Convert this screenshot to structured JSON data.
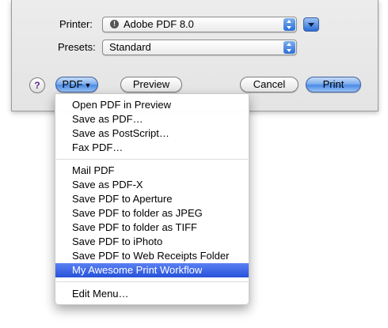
{
  "dialog": {
    "printer_label": "Printer:",
    "printer_value": "Adobe PDF 8.0",
    "presets_label": "Presets:",
    "presets_value": "Standard",
    "help_label": "?",
    "pdf_button": "PDF",
    "preview_button": "Preview",
    "cancel_button": "Cancel",
    "print_button": "Print"
  },
  "pdf_menu": {
    "group1": [
      "Open PDF in Preview",
      "Save as PDF…",
      "Save as PostScript…",
      "Fax PDF…"
    ],
    "group2": [
      "Mail PDF",
      "Save as PDF-X",
      "Save PDF to Aperture",
      "Save PDF to folder as JPEG",
      "Save PDF to folder as TIFF",
      "Save PDF to iPhoto",
      "Save PDF to Web Receipts Folder",
      "My Awesome Print Workflow"
    ],
    "group3": [
      "Edit Menu…"
    ],
    "selected_item": "My Awesome Print Workflow"
  },
  "colors": {
    "accent": "#3a66e0",
    "selection": "#2c5ae0"
  }
}
